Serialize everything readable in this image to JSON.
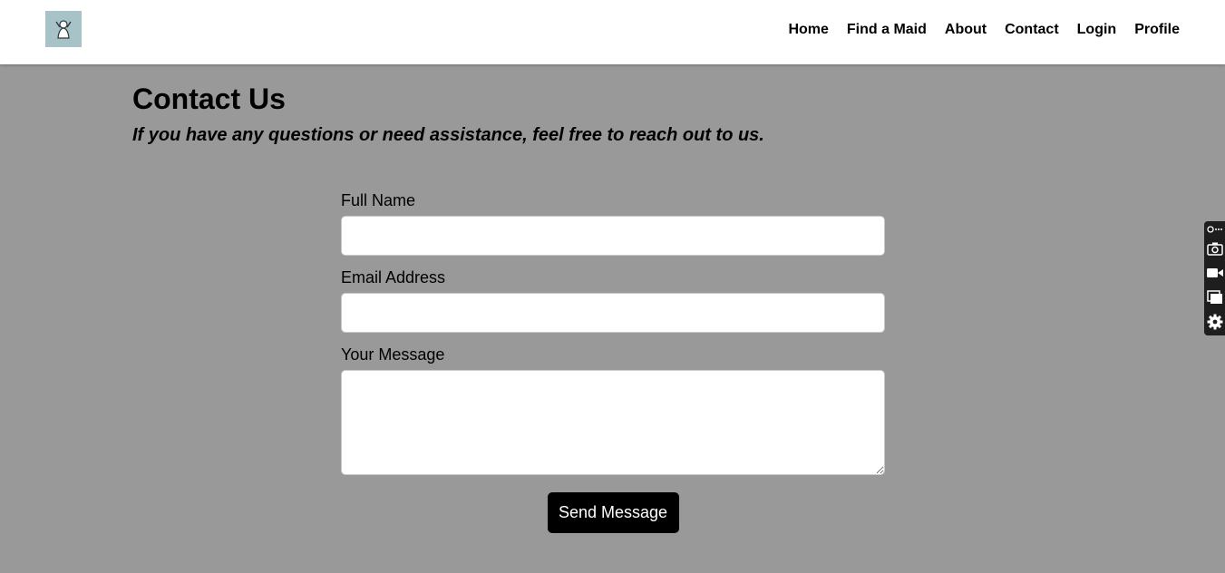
{
  "nav": {
    "logo_icon": "maid-logo-icon",
    "links": [
      {
        "label": "Home"
      },
      {
        "label": "Find a Maid"
      },
      {
        "label": "About"
      },
      {
        "label": "Contact"
      },
      {
        "label": "Login"
      },
      {
        "label": "Profile"
      }
    ]
  },
  "page": {
    "title": "Contact Us",
    "subtitle": "If you have any questions or need assistance, feel free to reach out to us."
  },
  "form": {
    "name_label": "Full Name",
    "name_value": "",
    "email_label": "Email Address",
    "email_value": "",
    "message_label": "Your Message",
    "message_value": "",
    "submit_label": "Send Message"
  },
  "toolbar": {
    "icons": [
      "link-icon",
      "camera-icon",
      "video-icon",
      "windows-icon",
      "gear-icon"
    ]
  },
  "colors": {
    "background": "#999999",
    "navbar": "#ffffff",
    "button": "#000000",
    "logo_bg": "#a7c3c8"
  }
}
